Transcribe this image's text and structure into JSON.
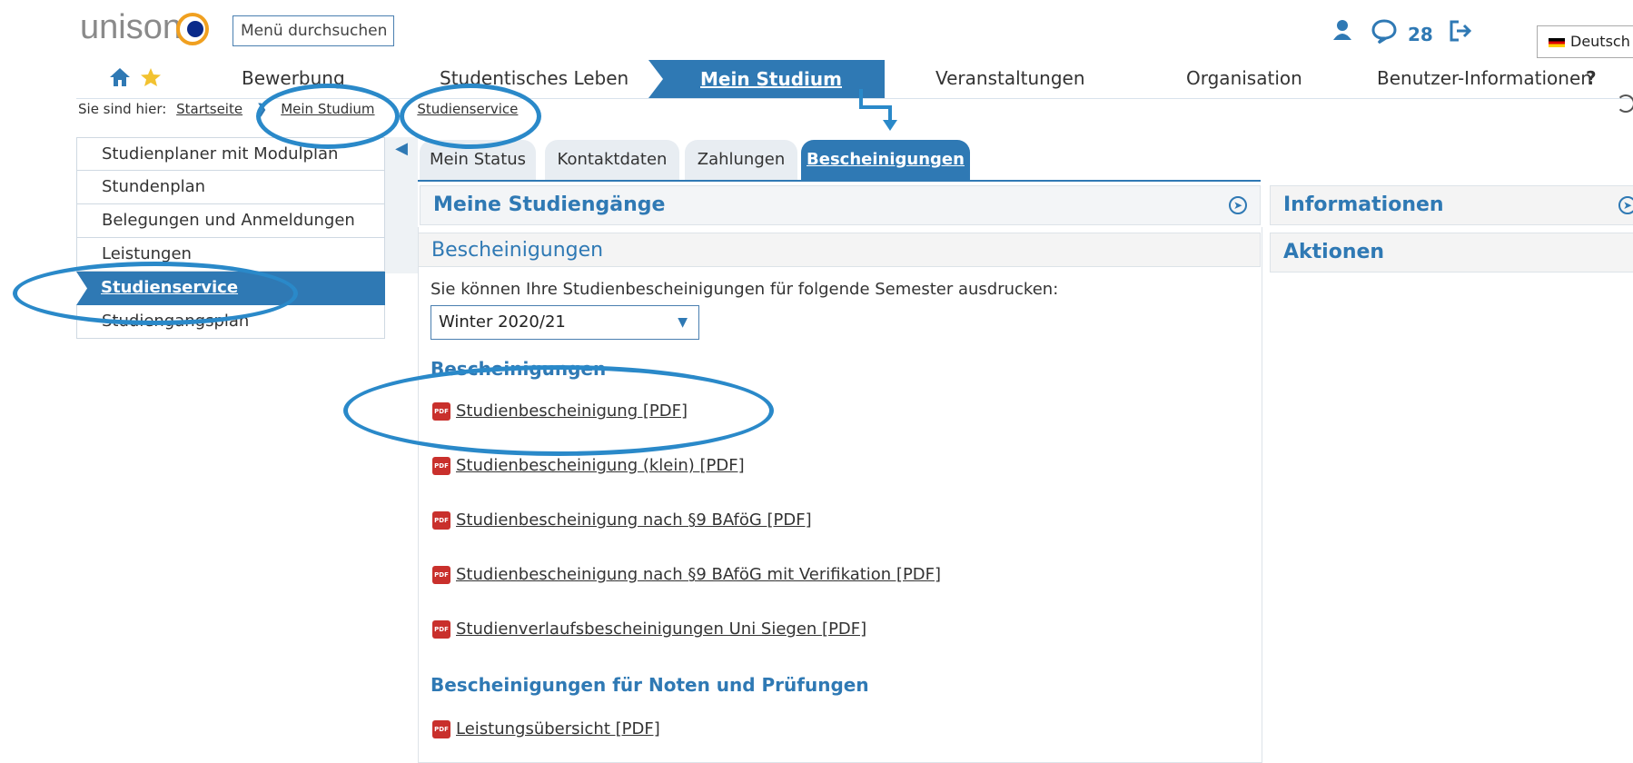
{
  "header": {
    "logo_text": "unison",
    "search_label": "Menü durchsuchen",
    "message_count": "28",
    "language": "Deutsch",
    "help": "?"
  },
  "nav": {
    "items": [
      "Bewerbung",
      "Studentisches Leben",
      "Mein Studium",
      "Veranstaltungen",
      "Organisation",
      "Benutzer-Informationen"
    ],
    "active": "Mein Studium"
  },
  "breadcrumb": {
    "prefix": "Sie sind hier:",
    "items": [
      "Startseite",
      "Mein Studium",
      "Studienservice"
    ]
  },
  "sidebar": {
    "items": [
      "Studienplaner mit Modulplan",
      "Stundenplan",
      "Belegungen und Anmeldungen",
      "Leistungen",
      "Studienservice",
      "Studiengangsplan"
    ],
    "active": "Studienservice"
  },
  "tabs": [
    "Mein Status",
    "Kontaktdaten",
    "Zahlungen",
    "Bescheinigungen"
  ],
  "main": {
    "studiengaenge_title": "Meine Studiengänge",
    "section_title": "Bescheinigungen",
    "description": "Sie können Ihre Studienbescheinigungen für folgende Semester ausdrucken:",
    "semester_selected": "Winter 2020/21",
    "subsection1": "Bescheinigungen",
    "pdf_links": [
      "Studienbescheinigung [PDF]",
      "Studienbescheinigung (klein) [PDF]",
      "Studienbescheinigung nach §9 BAföG [PDF]",
      "Studienbescheinigung nach §9 BAföG mit Verifikation [PDF]",
      "Studienverlaufsbescheinigungen Uni Siegen [PDF]"
    ],
    "subsection2": "Bescheinigungen für Noten und Prüfungen",
    "grades_link": "Leistungsübersicht [PDF]"
  },
  "right_panel": {
    "info_title": "Informationen",
    "actions_title": "Aktionen"
  },
  "colors": {
    "accent": "#2f79b4",
    "highlight": "#2a89c9",
    "pdf": "#c9302c"
  }
}
